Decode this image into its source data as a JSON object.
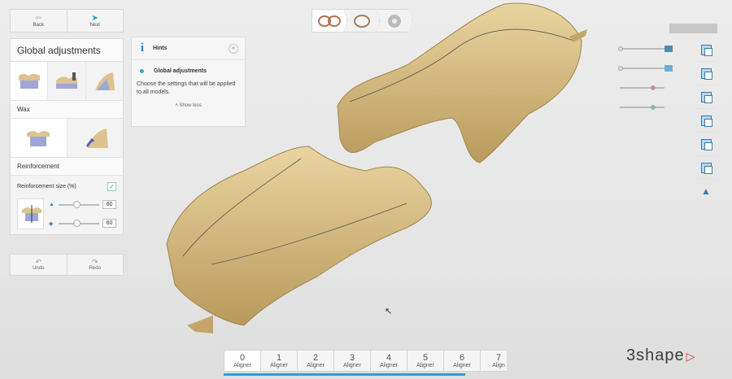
{
  "nav": {
    "back_label": "Back",
    "next_label": "Next"
  },
  "panel": {
    "title": "Global adjustments",
    "wax_label": "Wax",
    "reinforcement_label": "Reinforcement",
    "reinforcement_size_label": "Reinforcement size (%)",
    "reinforcement_checked": true,
    "slider1_value": "60",
    "slider2_value": "60"
  },
  "undo_redo": {
    "undo_label": "Undo",
    "redo_label": "Redo"
  },
  "hints": {
    "title": "Hints",
    "item_title": "Global adjustments",
    "item_text": "Choose the settings that will be applied to all models.",
    "show_less": "Show less"
  },
  "aligners": [
    {
      "num": "0",
      "label": "Aligner"
    },
    {
      "num": "1",
      "label": "Aligner"
    },
    {
      "num": "2",
      "label": "Aligner"
    },
    {
      "num": "3",
      "label": "Aligner"
    },
    {
      "num": "4",
      "label": "Aligner"
    },
    {
      "num": "5",
      "label": "Aligner"
    },
    {
      "num": "6",
      "label": "Aligner"
    },
    {
      "num": "7",
      "label": "Align"
    }
  ],
  "logo": "3shape",
  "colors": {
    "accent": "#2aa0d6",
    "model": "#d9c08a",
    "logo_mark": "#e0342c"
  }
}
